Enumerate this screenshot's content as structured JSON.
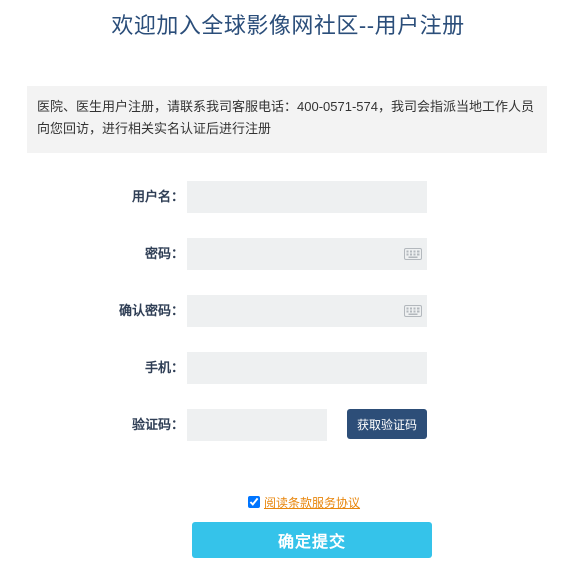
{
  "page": {
    "title": "欢迎加入全球影像网社区--用户注册"
  },
  "notice": {
    "text": "医院、医生用户注册，请联系我司客服电话：400-0571-574，我司会指派当地工作人员向您回访，进行相关实名认证后进行注册"
  },
  "form": {
    "username_label": "用户名：",
    "password_label": "密码：",
    "confirm_password_label": "确认密码：",
    "phone_label": "手机：",
    "code_label": "验证码：",
    "username_value": "",
    "password_value": "",
    "confirm_password_value": "",
    "phone_value": "",
    "code_value": "",
    "get_code_button": "获取验证码",
    "keyboard_icon": "keyboard-icon"
  },
  "agreement": {
    "checked": true,
    "link_text": "阅读条款服务协议"
  },
  "submit": {
    "label": "确定提交"
  },
  "colors": {
    "title": "#2b4e7a",
    "label": "#2f3e55",
    "input_bg": "#eef0f1",
    "code_button_bg": "#2d4e78",
    "submit_bg": "#35c3ea",
    "link": "#e8860c",
    "notice_bg": "#f3f3f3"
  }
}
